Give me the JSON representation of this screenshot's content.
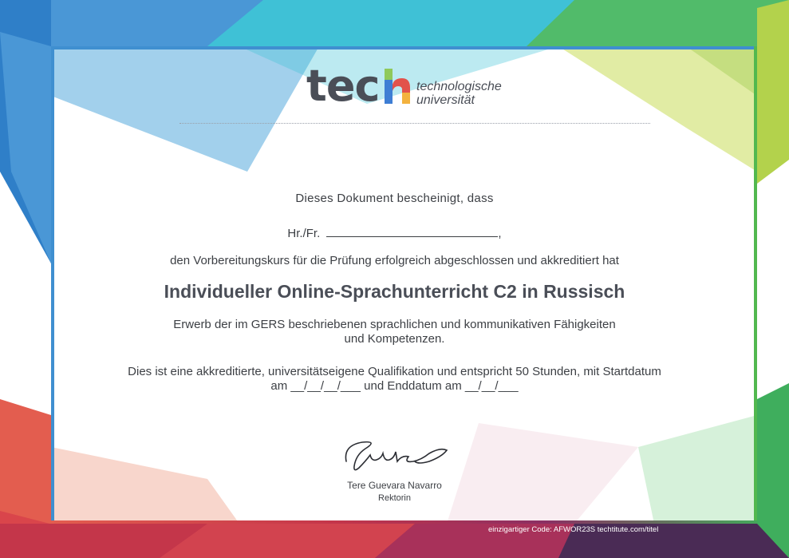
{
  "logo": {
    "wordmark": "tec",
    "letter": "h",
    "line1": "technologische",
    "line2": "universität"
  },
  "certificate": {
    "intro": "Dieses Dokument bescheinigt, dass",
    "recipient_label": "Hr./Fr.",
    "recipient_suffix": ",",
    "completion": "den Vorbereitungskurs für die Prüfung erfolgreich abgeschlossen und akkreditiert hat",
    "course_title": "Individueller Online-Sprachunterricht C2 in Russisch",
    "description_line1": "Erwerb der im GERS beschriebenen sprachlichen und kommunikativen Fähigkeiten",
    "description_line2": "und Kompetenzen.",
    "accreditation_line1": "Dies ist eine akkreditierte, universitätseigene Qualifikation und entspricht 50 Stunden, mit Startdatum",
    "accreditation_line2": "am __/__/__/___ und  Enddatum am __/__/___"
  },
  "signature": {
    "name": "Tere Guevara Navarro",
    "role": "Rektorin"
  },
  "footer": {
    "code": "einzigartiger Code: AFWOR23S   techtitute.com/titel"
  },
  "colors": {
    "text": "#3c3f44",
    "blue": "#3f8fd0",
    "cyan": "#3ec3d8",
    "green": "#4fb85a",
    "lime": "#c9dc5a",
    "red": "#e35d4f",
    "crimson": "#c4364a",
    "plum": "#6d2d5e"
  }
}
